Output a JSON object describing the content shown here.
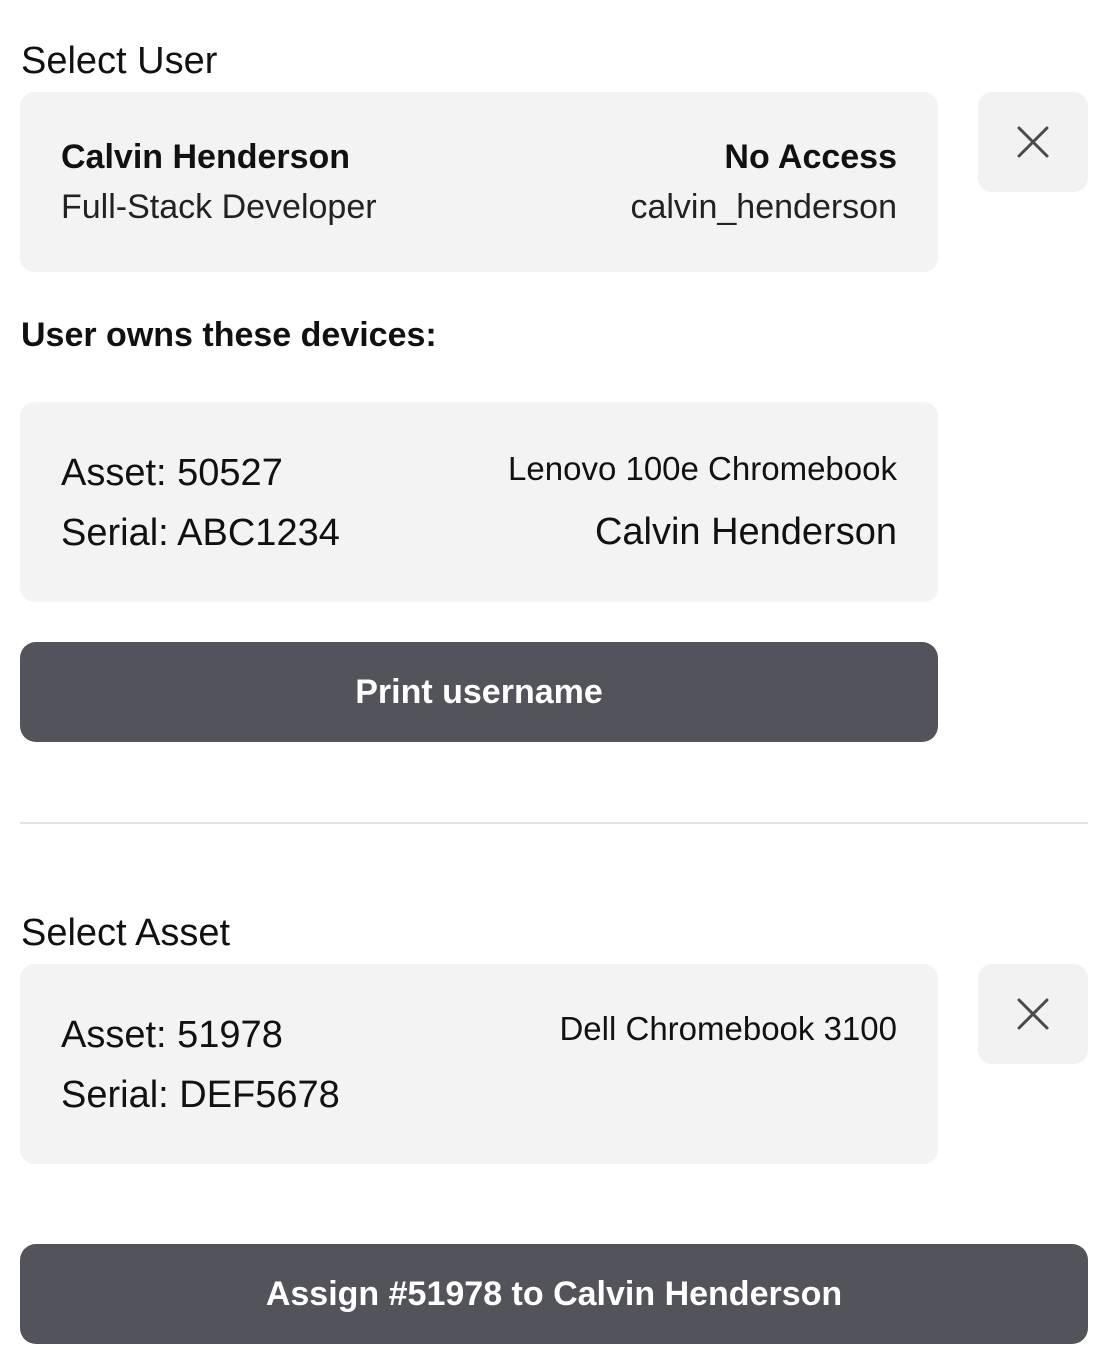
{
  "user_section": {
    "label": "Select User",
    "user": {
      "name": "Calvin Henderson",
      "title": "Full-Stack Developer",
      "access": "No Access",
      "username": "calvin_henderson"
    },
    "clear_icon": "close-icon"
  },
  "devices": {
    "heading": "User owns these devices:",
    "items": [
      {
        "asset": "Asset: 50527",
        "serial": "Serial: ABC1234",
        "model": "Lenovo 100e Chromebook",
        "owner": "Calvin Henderson"
      }
    ]
  },
  "print_button": {
    "label": "Print username"
  },
  "asset_section": {
    "label": "Select Asset",
    "asset": {
      "asset": "Asset: 51978",
      "serial": "Serial: DEF5678",
      "model": "Dell Chromebook 3100"
    },
    "clear_icon": "close-icon"
  },
  "assign_button": {
    "label": "Assign #51978 to Calvin Henderson"
  },
  "colors": {
    "card_bg": "#f3f3f3",
    "button_bg": "#53535b",
    "button_text": "#ffffff",
    "divider": "#e3e3e3"
  }
}
